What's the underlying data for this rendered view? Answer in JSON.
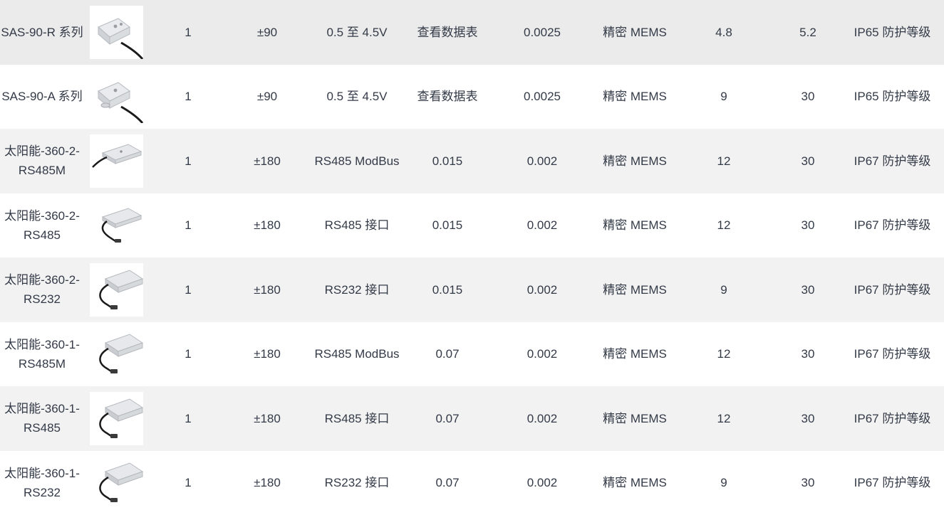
{
  "rows": [
    {
      "model": "SAS-90-R 系列",
      "device": "enclosure-black-cable",
      "axes": "1",
      "range": "±90",
      "output": "0.5 至 4.5V",
      "resolution": "查看数据表",
      "accuracy": "0.0025",
      "sensor": "精密 MEMS",
      "v1": "4.8",
      "v2": "5.2",
      "protection": "IP65 防护等级"
    },
    {
      "model": "SAS-90-A 系列",
      "device": "enclosure-black-cable",
      "axes": "1",
      "range": "±90",
      "output": "0.5 至 4.5V",
      "resolution": "查看数据表",
      "accuracy": "0.0025",
      "sensor": "精密 MEMS",
      "v1": "9",
      "v2": "30",
      "protection": "IP65 防护等级"
    },
    {
      "model": "太阳能-360-2-RS485M",
      "device": "enclosure-m12-connector",
      "axes": "1",
      "range": "±180",
      "output": "RS485 ModBus",
      "resolution": "0.015",
      "accuracy": "0.002",
      "sensor": "精密 MEMS",
      "v1": "12",
      "v2": "30",
      "protection": "IP67 防护等级"
    },
    {
      "model": "太阳能-360-2-RS485",
      "device": "enclosure-m12-connector",
      "axes": "1",
      "range": "±180",
      "output": "RS485 接口",
      "resolution": "0.015",
      "accuracy": "0.002",
      "sensor": "精密 MEMS",
      "v1": "12",
      "v2": "30",
      "protection": "IP67 防护等级"
    },
    {
      "model": "太阳能-360-2-RS232",
      "device": "enclosure-m12-connector",
      "axes": "1",
      "range": "±180",
      "output": "RS232 接口",
      "resolution": "0.015",
      "accuracy": "0.002",
      "sensor": "精密 MEMS",
      "v1": "9",
      "v2": "30",
      "protection": "IP67 防护等级"
    },
    {
      "model": "太阳能-360-1-RS485M",
      "device": "enclosure-m12-connector",
      "axes": "1",
      "range": "±180",
      "output": "RS485 ModBus",
      "resolution": "0.07",
      "accuracy": "0.002",
      "sensor": "精密 MEMS",
      "v1": "12",
      "v2": "30",
      "protection": "IP67 防护等级"
    },
    {
      "model": "太阳能-360-1-RS485",
      "device": "enclosure-m12-connector",
      "axes": "1",
      "range": "±180",
      "output": "RS485 接口",
      "resolution": "0.07",
      "accuracy": "0.002",
      "sensor": "精密 MEMS",
      "v1": "12",
      "v2": "30",
      "protection": "IP67 防护等级"
    },
    {
      "model": "太阳能-360-1-RS232",
      "device": "enclosure-m12-connector",
      "axes": "1",
      "range": "±180",
      "output": "RS232 接口",
      "resolution": "0.07",
      "accuracy": "0.002",
      "sensor": "精密 MEMS",
      "v1": "9",
      "v2": "30",
      "protection": "IP67 防护等级"
    }
  ]
}
